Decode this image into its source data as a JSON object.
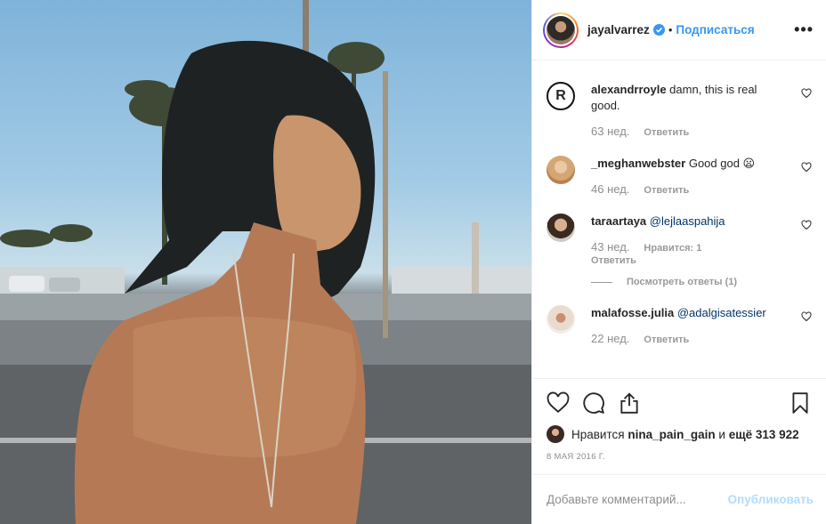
{
  "header": {
    "username": "jayalvarrez",
    "separator": "•",
    "follow_label": "Подписаться",
    "more_label": "•••"
  },
  "comments": [
    {
      "user": "alexandrroyle",
      "text": "damn, this is real good.",
      "mention": "",
      "time": "63 нед.",
      "likes": "",
      "reply_label": "Ответить",
      "avatar": "registered-logo-icon"
    },
    {
      "user": "_meghanwebster",
      "text": "Good god 😦",
      "mention": "",
      "time": "46 нед.",
      "likes": "",
      "reply_label": "Ответить",
      "avatar": "user-photo"
    },
    {
      "user": "taraartaya",
      "text": "",
      "mention": "@lejlaaspahija",
      "time": "43 нед.",
      "likes": "Нравится: 1",
      "reply_label": "Ответить",
      "avatar": "user-photo",
      "view_replies": "Посмотреть ответы (1)"
    },
    {
      "user": "malafosse.julia",
      "text": "",
      "mention": "@adalgisatessier",
      "time": "22 нед.",
      "likes": "",
      "reply_label": "Ответить",
      "avatar": "user-photo"
    }
  ],
  "actions": {
    "icons": [
      "heart-icon",
      "comment-icon",
      "share-icon",
      "bookmark-icon"
    ],
    "likes_prefix": "Нравится",
    "likes_user": "nina_pain_gain",
    "likes_middle": "и",
    "likes_count": "ещё 313 922",
    "date": "8 МАЯ 2016 Г."
  },
  "add_comment": {
    "placeholder": "Добавьте комментарий...",
    "publish_label": "Опубликовать"
  },
  "colors": {
    "link": "#3897f0",
    "mention": "#003569",
    "publish_disabled": "#b3dbff",
    "muted": "#8e8e8e"
  }
}
